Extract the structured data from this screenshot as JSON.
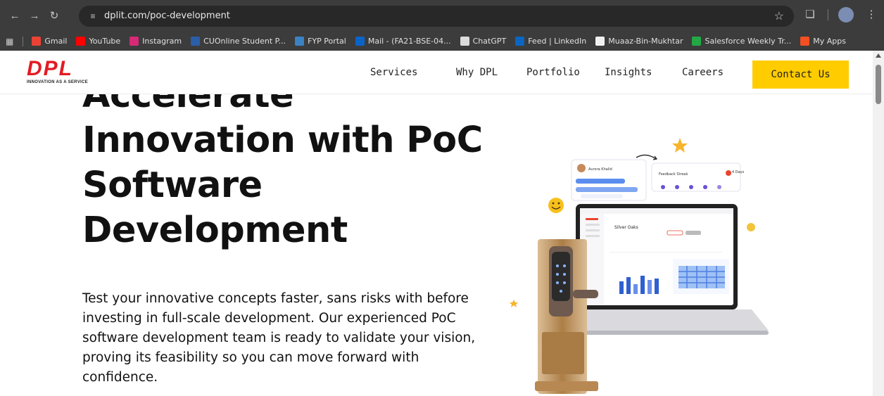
{
  "browser": {
    "url": "dplit.com/poc-development",
    "bookmarks": [
      {
        "label": "Gmail",
        "color": "#ea4335"
      },
      {
        "label": "YouTube",
        "color": "#ff0000"
      },
      {
        "label": "Instagram",
        "color": "#d62976"
      },
      {
        "label": "CUOnline Student P...",
        "color": "#2b5ea8"
      },
      {
        "label": "FYP Portal",
        "color": "#3b82c4"
      },
      {
        "label": "Mail - (FA21-BSE-04...",
        "color": "#0a64c8"
      },
      {
        "label": "ChatGPT",
        "color": "#dcdcdc"
      },
      {
        "label": "Feed | LinkedIn",
        "color": "#0a66c2"
      },
      {
        "label": "Muaaz-Bin-Mukhtar",
        "color": "#f0f0f0"
      },
      {
        "label": "Salesforce Weekly Tr...",
        "color": "#22a845"
      },
      {
        "label": "My Apps",
        "color": "#f25022"
      }
    ]
  },
  "site": {
    "logo_text": "DPL",
    "logo_tagline": "INNOVATION AS A SERVICE",
    "nav": [
      "Services",
      "Why DPL",
      "Portfolio",
      "Insights",
      "Careers"
    ],
    "contact_label": "Contact Us",
    "brand_red": "#e31b23",
    "accent_yellow": "#ffcc00"
  },
  "hero": {
    "title_lines": [
      "Accelerate",
      "Innovation with PoC",
      "Software",
      "Development"
    ],
    "description": "Test your innovative concepts faster, sans risks with before investing in full-scale development. Our experienced PoC software development team is ready to validate your vision, proving its feasibility so you can move forward with confidence."
  },
  "illustration": {
    "card1_name": "Aurora Khalid",
    "card2_title": "Feedback Streak",
    "card2_badge": "4 Days",
    "screen_heading": "Silver Oaks"
  }
}
